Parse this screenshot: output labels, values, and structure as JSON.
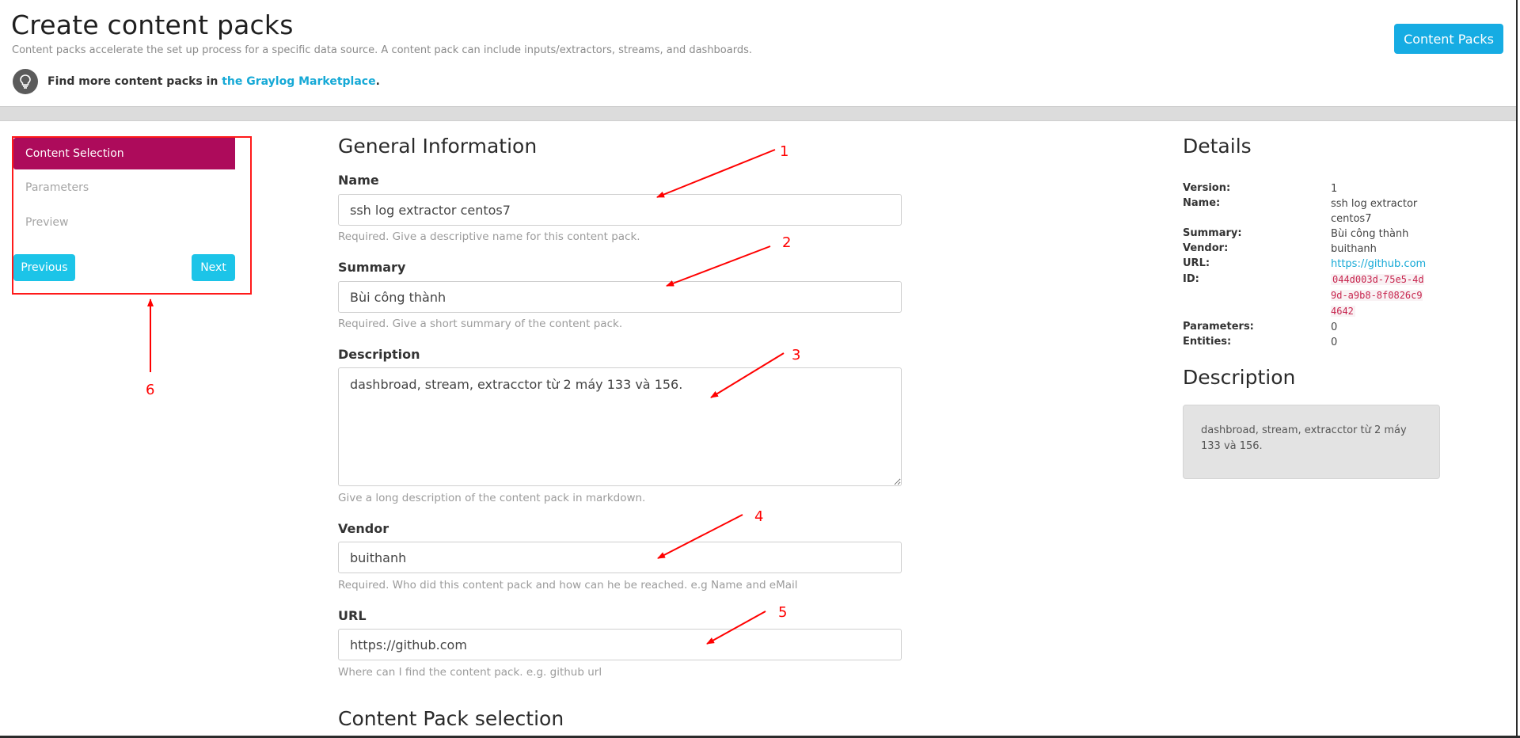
{
  "header": {
    "title": "Create content packs",
    "subtitle": "Content packs accelerate the set up process for a specific data source. A content pack can include inputs/extractors, streams, and dashboards.",
    "marketplace_prefix": "Find more content packs in",
    "marketplace_link": "the Graylog Marketplace",
    "marketplace_suffix": ".",
    "content_packs_button": "Content Packs"
  },
  "wizard": {
    "steps": [
      {
        "label": "Content Selection",
        "active": true
      },
      {
        "label": "Parameters",
        "active": false
      },
      {
        "label": "Preview",
        "active": false
      }
    ],
    "previous_label": "Previous",
    "next_label": "Next"
  },
  "form": {
    "section_title": "General Information",
    "name": {
      "label": "Name",
      "value": "ssh log extractor centos7",
      "help": "Required. Give a descriptive name for this content pack."
    },
    "summary": {
      "label": "Summary",
      "value": "Bùi công thành",
      "help": "Required. Give a short summary of the content pack."
    },
    "description": {
      "label": "Description",
      "value": "dashbroad, stream, extracctor từ 2 máy 133 và 156.",
      "help": "Give a long description of the content pack in markdown."
    },
    "vendor": {
      "label": "Vendor",
      "value": "buithanh",
      "help": "Required. Who did this content pack and how can he be reached. e.g Name and eMail"
    },
    "url": {
      "label": "URL",
      "value": "https://github.com",
      "help": "Where can I find the content pack. e.g. github url"
    },
    "selection_title": "Content Pack selection"
  },
  "details": {
    "title": "Details",
    "version_label": "Version:",
    "version": "1",
    "name_label": "Name:",
    "name": "ssh log extractor centos7",
    "summary_label": "Summary:",
    "summary": "Bùi công thành",
    "vendor_label": "Vendor:",
    "vendor": "buithanh",
    "url_label": "URL:",
    "url": "https://github.com",
    "id_label": "ID:",
    "id": "044d003d-75e5-4d9d-a9b8-8f0826c94642",
    "parameters_label": "Parameters:",
    "parameters": "0",
    "entities_label": "Entities:",
    "entities": "0",
    "description_title": "Description",
    "description": "dashbroad, stream, extracctor từ 2 máy 133 và 156."
  },
  "annotations": [
    "1",
    "2",
    "3",
    "4",
    "5",
    "6"
  ],
  "colors": {
    "accent": "#16ace3",
    "wizard_active": "#ad0b5b",
    "annotation": "#ff0000"
  }
}
